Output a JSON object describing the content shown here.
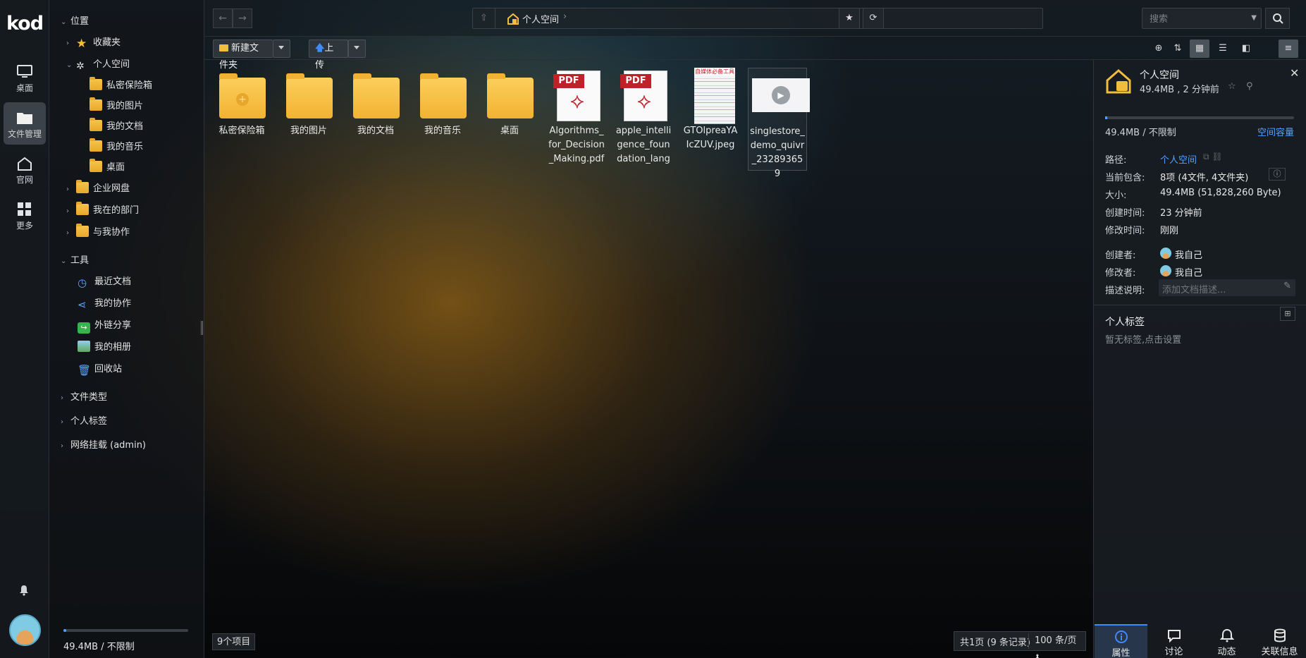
{
  "app": {
    "logo": "kod"
  },
  "rail": {
    "items": [
      {
        "label": "桌面",
        "icon": "monitor-icon"
      },
      {
        "label": "文件管理",
        "icon": "folder-icon",
        "active": true
      },
      {
        "label": "官网",
        "icon": "home-icon"
      },
      {
        "label": "更多",
        "icon": "grid-icon"
      }
    ]
  },
  "tree": {
    "section_location": "位置",
    "favorites": "收藏夹",
    "personal_space": "个人空间",
    "personal_children": [
      "私密保险箱",
      "我的图片",
      "我的文档",
      "我的音乐",
      "桌面"
    ],
    "enterprise_disk": "企业网盘",
    "my_department": "我在的部门",
    "shared_with_me": "与我协作",
    "section_tools": "工具",
    "tools": [
      "最近文档",
      "我的协作",
      "外链分享",
      "我的相册",
      "回收站"
    ],
    "file_types": "文件类型",
    "personal_tags": "个人标签",
    "network_mount": "网络挂载 (admin)",
    "quota": "49.4MB / 不限制"
  },
  "topbar": {
    "breadcrumb": "个人空间",
    "search_placeholder": "搜索"
  },
  "toolbar": {
    "new_folder": "新建文件夹",
    "upload": "上传"
  },
  "files": [
    {
      "name": "私密保险箱",
      "type": "safe-folder"
    },
    {
      "name": "我的图片",
      "type": "folder"
    },
    {
      "name": "我的文档",
      "type": "folder"
    },
    {
      "name": "我的音乐",
      "type": "folder"
    },
    {
      "name": "桌面",
      "type": "folder"
    },
    {
      "name": "Algorithms_for_Decision_Making.pdf",
      "type": "pdf"
    },
    {
      "name": "apple_intelligence_foundation_lang",
      "type": "pdf"
    },
    {
      "name": "GTOlpreaYAIcZUV.jpeg",
      "type": "image"
    },
    {
      "name": "singlestore_demo_quivr_232893659",
      "type": "video"
    }
  ],
  "pdf_tag": "PDF",
  "jpeg_thumb_title": "自媒体必备工具",
  "status": {
    "count": "9个项目",
    "pages": "共1页 (9 条记录)",
    "per_page": "100 条/页"
  },
  "panel": {
    "title": "个人空间",
    "subtitle": "49.4MB , 2 分钟前",
    "quota": "49.4MB / 不限制",
    "quota_link": "空间容量",
    "path_label": "路径:",
    "path_value": "个人空间",
    "contains_label": "当前包含:",
    "contains_value": "8项 (4文件, 4文件夹)",
    "size_label": "大小:",
    "size_value": "49.4MB (51,828,260 Byte)",
    "created_label": "创建时间:",
    "created_value": "23 分钟前",
    "modified_label": "修改时间:",
    "modified_value": "刚刚",
    "creator_label": "创建者:",
    "creator_value": "我自己",
    "modifier_label": "修改者:",
    "modifier_value": "我自己",
    "desc_label": "描述说明:",
    "desc_placeholder": "添加文档描述...",
    "tags_title": "个人标签",
    "tags_empty": "暂无标签,点击设置",
    "tabs": [
      "属性",
      "讨论",
      "动态",
      "关联信息"
    ]
  },
  "colors": {
    "accent": "#4ea1ff",
    "folder": "#f4bb3a",
    "pdf_red": "#c0202a"
  }
}
